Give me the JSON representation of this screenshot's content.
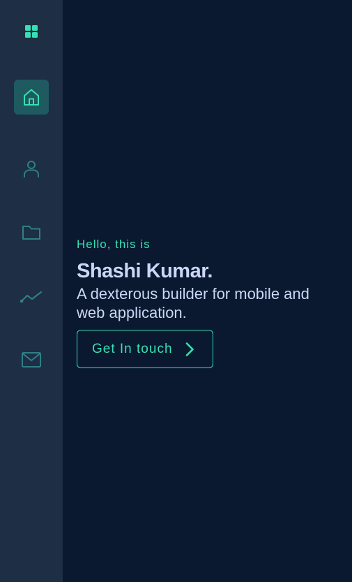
{
  "sidebar": {
    "logo_icon": "grid-icon",
    "items": [
      {
        "id": "home",
        "icon": "home-icon",
        "active": true
      },
      {
        "id": "about",
        "icon": "user-icon",
        "active": false
      },
      {
        "id": "projects",
        "icon": "folder-icon",
        "active": false
      },
      {
        "id": "activity",
        "icon": "trend-icon",
        "active": false
      },
      {
        "id": "contact",
        "icon": "mail-icon",
        "active": false
      }
    ]
  },
  "hero": {
    "greeting": "Hello, this is",
    "name": "Shashi Kumar.",
    "tagline": "A dexterous builder for mobile and web application.",
    "cta_label": "Get In touch",
    "cta_icon": "chevron-right-icon"
  },
  "colors": {
    "background": "#0a192f",
    "sidebar": "#1e2e44",
    "accent": "#37e0b4",
    "active_bg": "#1e5a5f",
    "text_primary": "#ccd6f6",
    "icon_inactive": "#2f7f86"
  }
}
